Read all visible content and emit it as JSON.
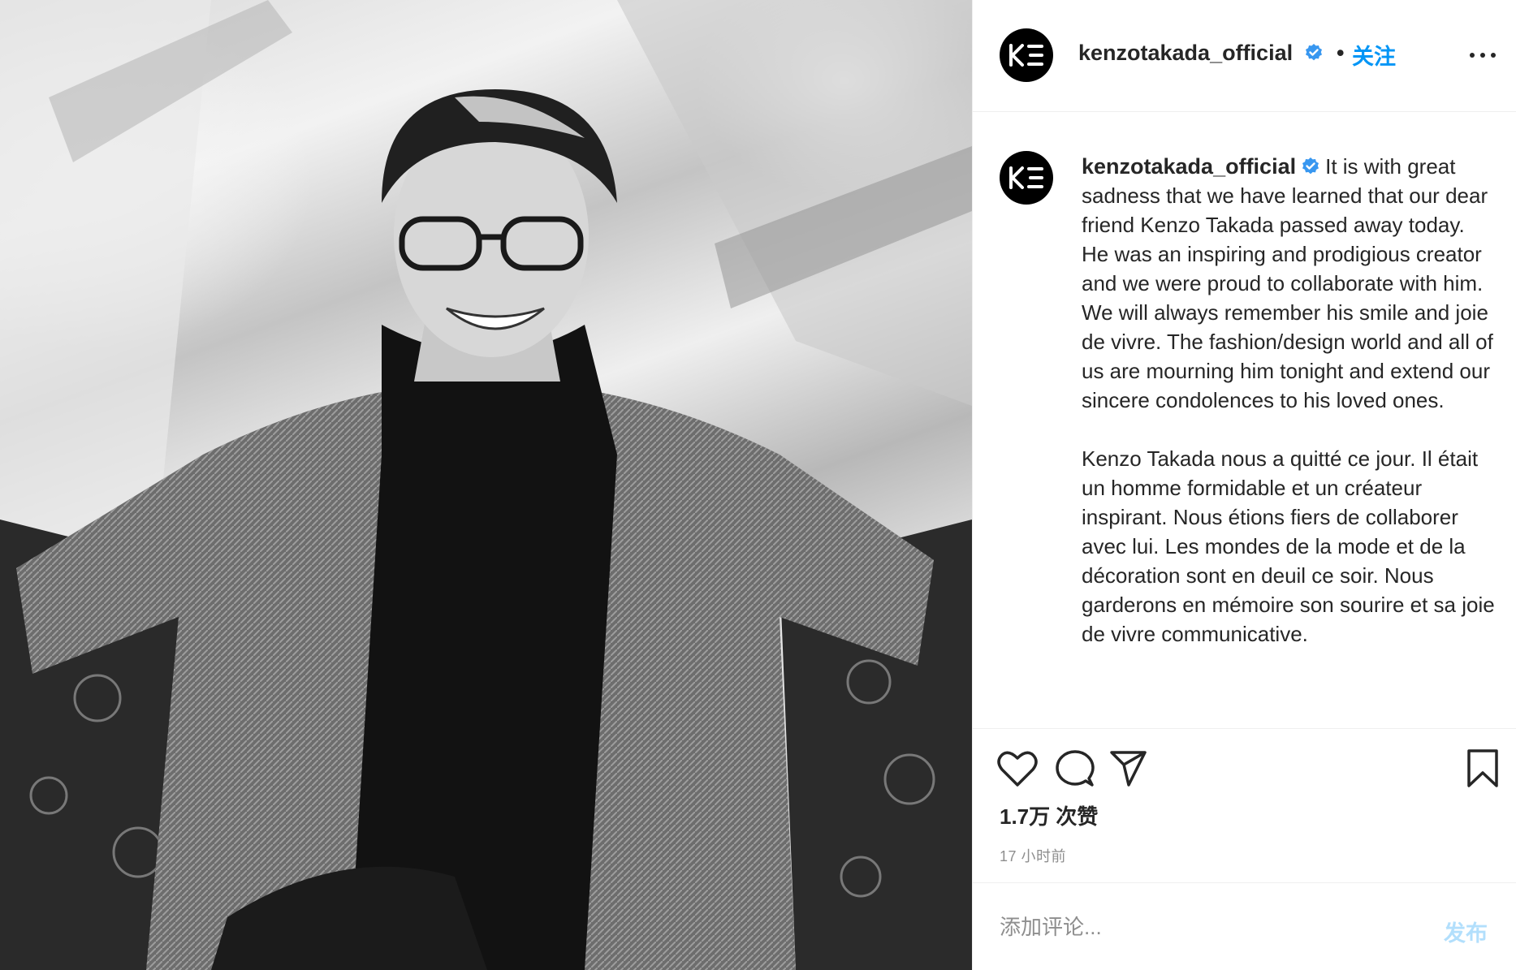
{
  "post": {
    "image_alt": "Black and white portrait photo",
    "username": "kenzotakada_official",
    "separator": "•",
    "follow_label": "关注",
    "logo_text": "KƎ",
    "caption_paragraph_1": "It is with great sadness that we have learned that our dear friend Kenzo Takada passed away today. He was an inspiring and prodigious creator and we were proud to collaborate with him. We will always remember his smile and joie de vivre. The fashion/design world and all of us are mourning him tonight and extend our sincere condolences to his loved ones.",
    "caption_paragraph_2": "Kenzo Takada nous a quitté ce jour. Il était un homme formidable et un créateur inspirant. Nous étions fiers de collaborer avec lui. Les mondes de la mode et de la décoration sont en deuil ce soir. Nous garderons en mémoire son sourire et sa joie de vivre communicative.",
    "likes": "1.7万 次赞",
    "time": "17 小时前",
    "comment_placeholder": "添加评论...",
    "post_label": "发布"
  },
  "colors": {
    "accent": "#0095f6",
    "verified": "#3897f0",
    "post_disabled": "#b2dffc",
    "text": "#262626",
    "muted": "#8e8e8e"
  },
  "icons": [
    "verified-badge-icon",
    "more-options-icon",
    "heart-icon",
    "comment-icon",
    "share-icon",
    "bookmark-icon"
  ]
}
